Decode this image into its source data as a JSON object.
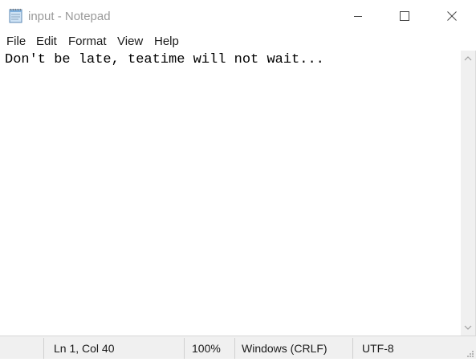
{
  "window": {
    "title": "input - Notepad",
    "icon": "notepad-icon"
  },
  "title_buttons": {
    "minimize_icon": "minimize-icon",
    "maximize_icon": "maximize-icon",
    "close_icon": "close-icon"
  },
  "menu": {
    "items": [
      {
        "label": "File"
      },
      {
        "label": "Edit"
      },
      {
        "label": "Format"
      },
      {
        "label": "View"
      },
      {
        "label": "Help"
      }
    ]
  },
  "editor": {
    "content": "Don't be late, teatime will not wait..."
  },
  "scrollbar": {
    "up_icon": "chevron-up-icon",
    "down_icon": "chevron-down-icon"
  },
  "statusbar": {
    "position": "Ln 1, Col 40",
    "zoom": "100%",
    "line_ending": "Windows (CRLF)",
    "encoding": "UTF-8"
  },
  "colors": {
    "title_text": "#9a9a9a",
    "statusbar_bg": "#f0f0f0",
    "scrollbar_bg": "#f0f0f0"
  }
}
